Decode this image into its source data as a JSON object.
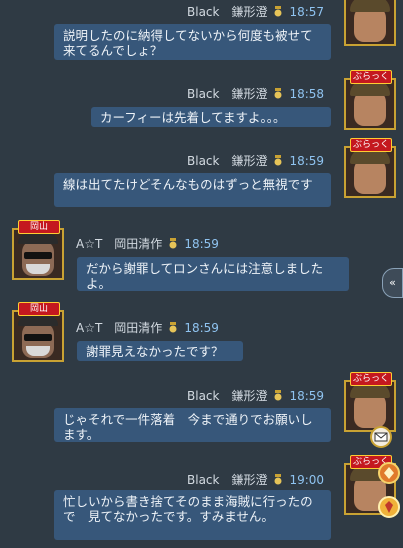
{
  "messages": [
    {
      "sender": "Black　鎌形澄",
      "time": "18:57",
      "text": "説明したのに納得してないから何度も被せて来てるんでしょ？",
      "side": "right",
      "tag": "ぶらっく"
    },
    {
      "sender": "Black　鎌形澄",
      "time": "18:58",
      "text": "カーフィーは先着してますよ。。。",
      "side": "right",
      "tag": "ぶらっく"
    },
    {
      "sender": "Black　鎌形澄",
      "time": "18:59",
      "text": "線は出てたけどそんなものはずっと無視です",
      "side": "right",
      "tag": "ぶらっく"
    },
    {
      "sender": "A☆T　岡田清作",
      "time": "18:59",
      "text": "だから謝罪してロンさんには注意しましたよ。",
      "side": "left",
      "tag": "岡山"
    },
    {
      "sender": "A☆T　岡田清作",
      "time": "18:59",
      "text": "謝罪見えなかったです？",
      "side": "left",
      "tag": "岡山"
    },
    {
      "sender": "Black　鎌形澄",
      "time": "18:59",
      "text": "じゃそれで一件落着　今まで通りでお願いします。",
      "side": "right",
      "tag": "ぶらっく"
    },
    {
      "sender": "Black　鎌形澄",
      "time": "19:00",
      "text": "忙しいから書き捨てそのまま海賊に行ったので　見てなかったです。すみません。",
      "side": "right",
      "tag": "ぶらっく"
    }
  ],
  "side_panel": {
    "expand_label": "«"
  },
  "colors": {
    "background": "#2f3a44",
    "bubble": "#37577a",
    "time": "#8fc3f0",
    "tag": "#c4181f"
  },
  "icons": [
    "medal-icon",
    "mail-icon",
    "skill-badge-icon",
    "gem-badge-icon",
    "double-chevron-left-icon"
  ]
}
